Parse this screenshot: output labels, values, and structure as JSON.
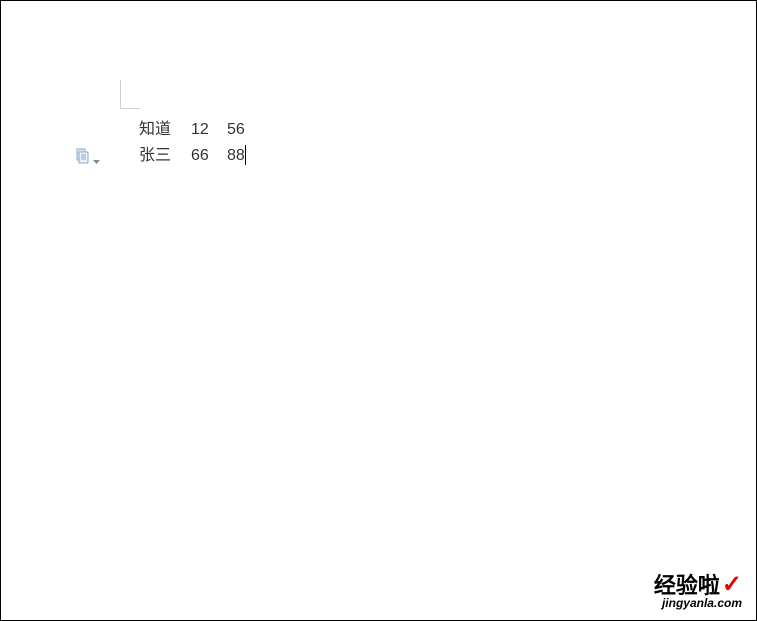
{
  "content": {
    "rows": [
      {
        "c1": "知道",
        "c2": "12",
        "c3": "56"
      },
      {
        "c1": "张三",
        "c2": "66",
        "c3": "88"
      }
    ]
  },
  "watermark": {
    "top": "经验啦",
    "check": "✓",
    "bottom": "jingyanla.com"
  }
}
